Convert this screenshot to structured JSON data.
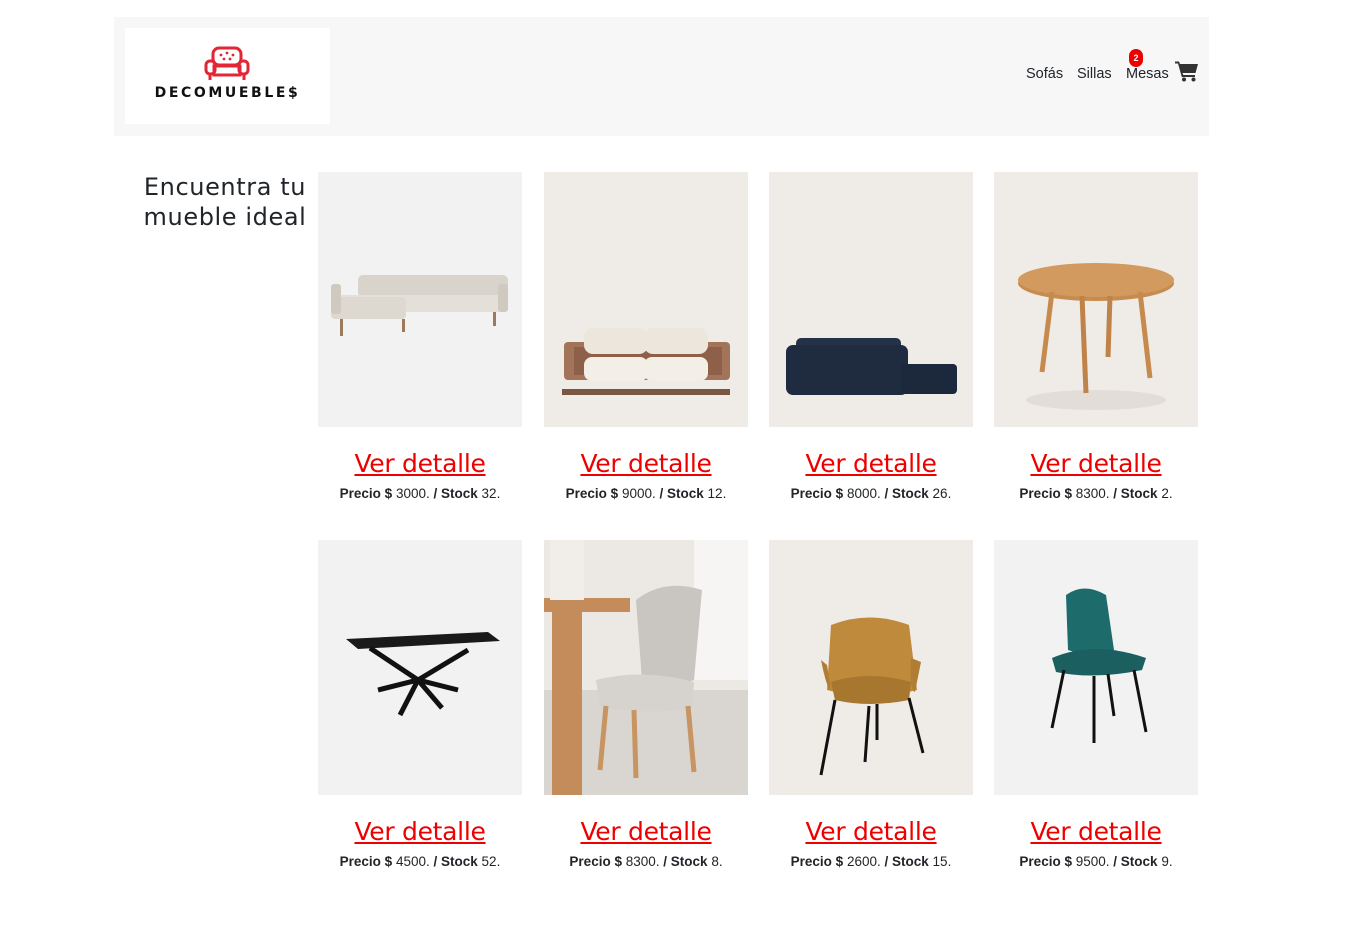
{
  "brand": {
    "name": "DECOMUEBLE$",
    "accent_color": "#ee0000"
  },
  "nav": {
    "links": [
      "Sofás",
      "Sillas",
      "Mesas"
    ],
    "cart_count": "2",
    "cart_icon": "shopping-cart-icon"
  },
  "sidebar": {
    "heading": "Encuentra tu mueble ideal"
  },
  "products": [
    {
      "name": "sofa-chaise-beige",
      "link": "Ver detalle",
      "price_label": "Precio $",
      "price": "3000.",
      "stock_label": "/ Stock",
      "stock": "32."
    },
    {
      "name": "sofa-cream-wood-base",
      "link": "Ver detalle",
      "price_label": "Precio $",
      "price": "9000.",
      "stock_label": "/ Stock",
      "stock": "12."
    },
    {
      "name": "sofa-navy-modular",
      "link": "Ver detalle",
      "price_label": "Precio $",
      "price": "8000.",
      "stock_label": "/ Stock",
      "stock": "26."
    },
    {
      "name": "table-round-oak",
      "link": "Ver detalle",
      "price_label": "Precio $",
      "price": "8300.",
      "stock_label": "/ Stock",
      "stock": "2."
    },
    {
      "name": "table-black-extendable",
      "link": "Ver detalle",
      "price_label": "Precio $",
      "price": "4500.",
      "stock_label": "/ Stock",
      "stock": "52."
    },
    {
      "name": "chair-grey-dining-scene",
      "link": "Ver detalle",
      "price_label": "Precio $",
      "price": "8300.",
      "stock_label": "/ Stock",
      "stock": "8."
    },
    {
      "name": "chair-mustard-armchair",
      "link": "Ver detalle",
      "price_label": "Precio $",
      "price": "2600.",
      "stock_label": "/ Stock",
      "stock": "15."
    },
    {
      "name": "chair-teal-velvet",
      "link": "Ver detalle",
      "price_label": "Precio $",
      "price": "9500.",
      "stock_label": "/ Stock",
      "stock": "9."
    }
  ]
}
